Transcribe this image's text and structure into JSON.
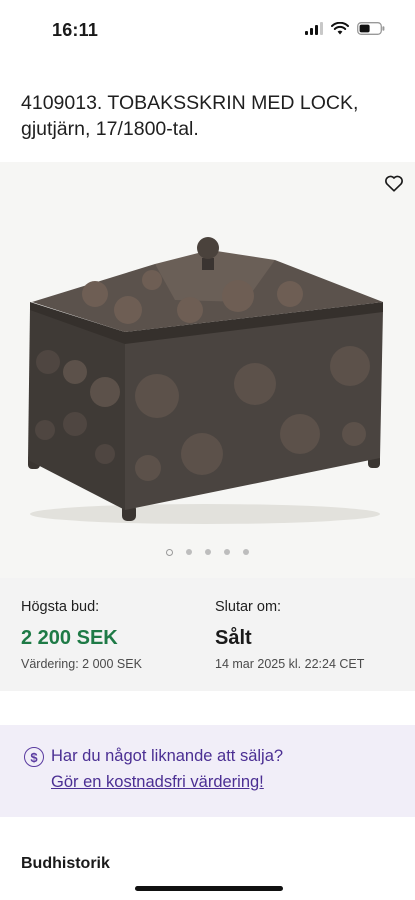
{
  "status": {
    "time": "16:11"
  },
  "listing": {
    "title": "4109013. TOBAKSSKRIN MED LOCK, gjutjärn, 17/1800-tal."
  },
  "gallery": {
    "image": "cast-iron-tobacco-box-photo",
    "dot_count": 5,
    "active_index": 0
  },
  "bid": {
    "highest_label": "Högsta bud:",
    "highest_value": "2 200 SEK",
    "valuation": "Värdering: 2 000 SEK",
    "ends_label": "Slutar om:",
    "ends_value": "Sålt",
    "ends_date": "14 mar 2025 kl. 22:24 CET"
  },
  "sell": {
    "icon": "dollar-circle-icon",
    "question": "Har du något liknande att sälja?",
    "link": "Gör en kostnadsfri värdering!"
  },
  "history": {
    "title": "Budhistorik"
  },
  "colors": {
    "accent_green": "#1e7a46",
    "accent_purple": "#4b2f93",
    "banner_bg": "#f1eef8"
  }
}
